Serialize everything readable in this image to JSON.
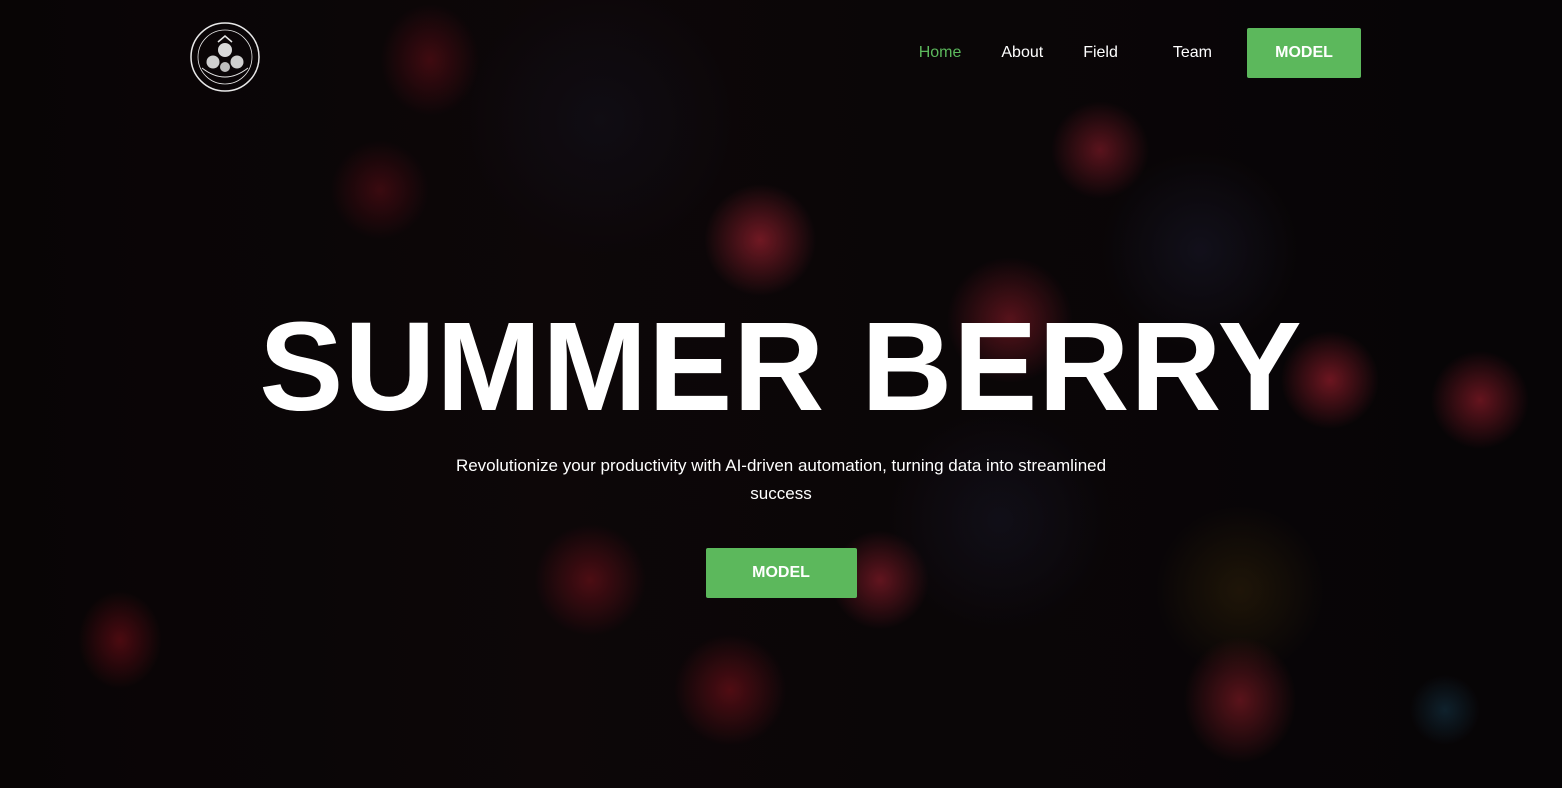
{
  "brand": {
    "logo_icon": "berry-seal-logo-icon"
  },
  "nav": {
    "links": [
      {
        "label": "Home",
        "active": true
      },
      {
        "label": "About",
        "active": false
      },
      {
        "label": "Field",
        "active": false
      },
      {
        "label": "Team",
        "active": false
      }
    ],
    "cta_label": "MODEL"
  },
  "hero": {
    "title": "SUMMER BERRY",
    "subtitle": "Revolutionize your productivity with AI-driven automation, turning data into streamlined success",
    "cta_label": "MODEL"
  },
  "colors": {
    "accent": "#5cb85c",
    "text": "#ffffff",
    "background": "#050305"
  }
}
